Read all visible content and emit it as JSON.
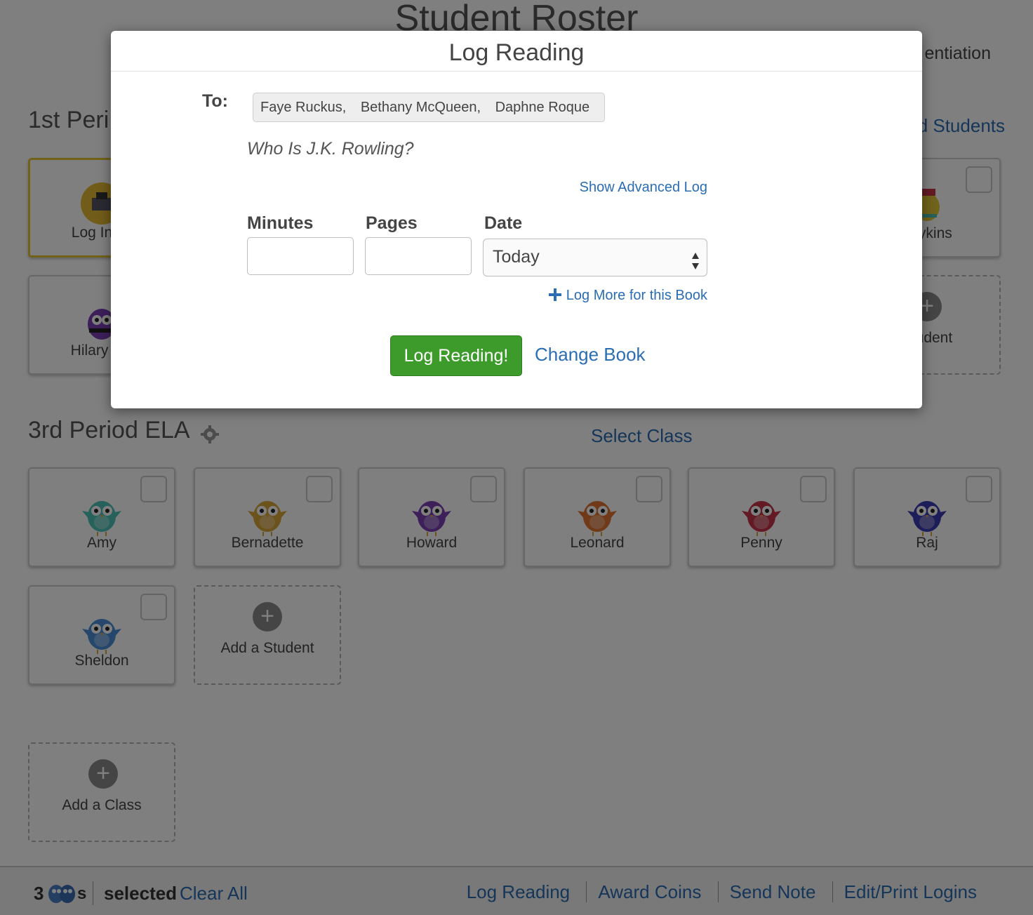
{
  "page": {
    "title": "Student Roster",
    "right_header_fragment": "entiation",
    "first_period_title": "1st Peri",
    "first_period_right_link": "d Students",
    "third_period_title": "3rd Period ELA",
    "select_class_label": "Select Class"
  },
  "first_period_cards": {
    "log_in_as": "Log In as",
    "hilary": "Hilary Ma",
    "lykins": "r Lykins",
    "add_student": "Student"
  },
  "third_period_students": [
    {
      "name": "Amy",
      "color": "#4cc3b7"
    },
    {
      "name": "Bernadette",
      "color": "#d8a437"
    },
    {
      "name": "Howard",
      "color": "#7b3fb5"
    },
    {
      "name": "Leonard",
      "color": "#e0722e"
    },
    {
      "name": "Penny",
      "color": "#c9344a"
    },
    {
      "name": "Raj",
      "color": "#3b3bb2"
    },
    {
      "name": "Sheldon",
      "color": "#4a8fd6"
    }
  ],
  "add_student_label": "Add a Student",
  "add_class_label": "Add a Class",
  "modal": {
    "title": "Log Reading",
    "to_label": "To:",
    "recipients": [
      "Faye Ruckus,",
      "Bethany McQueen,",
      "Daphne Roque"
    ],
    "book_title": "Who Is J.K. Rowling?",
    "show_advanced": "Show Advanced Log",
    "minutes_label": "Minutes",
    "pages_label": "Pages",
    "date_label": "Date",
    "date_value": "Today",
    "log_more": "Log More for this Book",
    "submit": "Log Reading!",
    "change_book": "Change Book"
  },
  "footer": {
    "count": "3",
    "plural_suffix": "s",
    "selected": "selected",
    "clear_all": "Clear All",
    "actions": [
      "Log Reading",
      "Award Coins",
      "Send Note",
      "Edit/Print Logins"
    ]
  },
  "colors": {
    "link": "#2a6db3",
    "primary_button": "#3d9b2b",
    "selected_border": "#e7c22e"
  }
}
